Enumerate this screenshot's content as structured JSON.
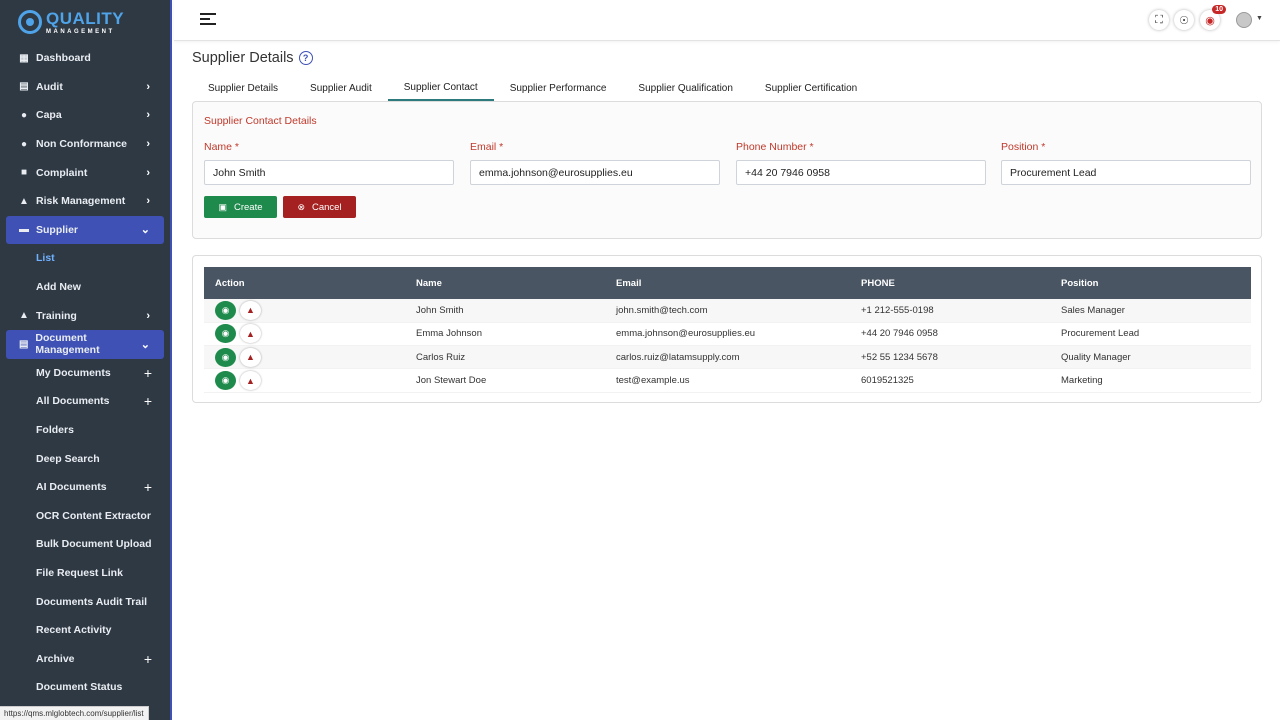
{
  "app": {
    "logo_title": "QUALITY",
    "logo_subtitle": "MANAGEMENT",
    "status_url": "https://qms.mlglobtech.com/supplier/list"
  },
  "sidebar": {
    "items": [
      {
        "label": "Dashboard",
        "icon": "grid-icon"
      },
      {
        "label": "Audit",
        "icon": "clipboard-icon"
      },
      {
        "label": "Capa",
        "icon": "shield-icon"
      },
      {
        "label": "Non Conformance",
        "icon": "alert-icon"
      },
      {
        "label": "Complaint",
        "icon": "comment-icon"
      },
      {
        "label": "Risk Management",
        "icon": "warning-icon"
      },
      {
        "label": "Supplier",
        "icon": "truck-icon"
      },
      {
        "label": "Training",
        "icon": "graduation-cap-icon"
      },
      {
        "label": "Document Management",
        "icon": "file-icon"
      }
    ],
    "supplier_sub": [
      {
        "label": "List"
      },
      {
        "label": "Add New"
      }
    ],
    "document_sub": [
      {
        "label": "My Documents"
      },
      {
        "label": "All Documents"
      },
      {
        "label": "Folders"
      },
      {
        "label": "Deep Search"
      },
      {
        "label": "AI Documents"
      },
      {
        "label": "OCR Content Extractor"
      },
      {
        "label": "Bulk Document Upload"
      },
      {
        "label": "File Request Link"
      },
      {
        "label": "Documents Audit Trail"
      },
      {
        "label": "Recent Activity"
      },
      {
        "label": "Archive"
      },
      {
        "label": "Document Status"
      }
    ]
  },
  "topbar": {
    "notification_count": "10"
  },
  "page": {
    "title": "Supplier Details",
    "help": "?"
  },
  "tabs": [
    {
      "label": "Supplier Details"
    },
    {
      "label": "Supplier Audit"
    },
    {
      "label": "Supplier Contact"
    },
    {
      "label": "Supplier Performance"
    },
    {
      "label": "Supplier Qualification"
    },
    {
      "label": "Supplier Certification"
    }
  ],
  "form": {
    "title": "Supplier Contact Details",
    "name_label": "Name *",
    "name_value": "John Smith",
    "email_label": "Email *",
    "email_value": "emma.johnson@eurosupplies.eu",
    "phone_label": "Phone Number *",
    "phone_value": "+44 20 7946 0958",
    "position_label": "Position *",
    "position_value": "Procurement Lead",
    "create_label": "Create",
    "cancel_label": "Cancel"
  },
  "table": {
    "headers": {
      "action": "Action",
      "name": "Name",
      "email": "Email",
      "phone": "PHONE",
      "position": "Position"
    },
    "rows": [
      {
        "name": "John Smith",
        "email": "john.smith@tech.com",
        "phone": "+1 212-555-0198",
        "position": "Sales Manager"
      },
      {
        "name": "Emma Johnson",
        "email": "emma.johnson@eurosupplies.eu",
        "phone": "+44 20 7946 0958",
        "position": "Procurement Lead"
      },
      {
        "name": "Carlos Ruiz",
        "email": "carlos.ruiz@latamsupply.com",
        "phone": "+52 55 1234 5678",
        "position": "Quality Manager"
      },
      {
        "name": "Jon Stewart Doe",
        "email": "test@example.us",
        "phone": "6019521325",
        "position": "Marketing"
      }
    ]
  }
}
